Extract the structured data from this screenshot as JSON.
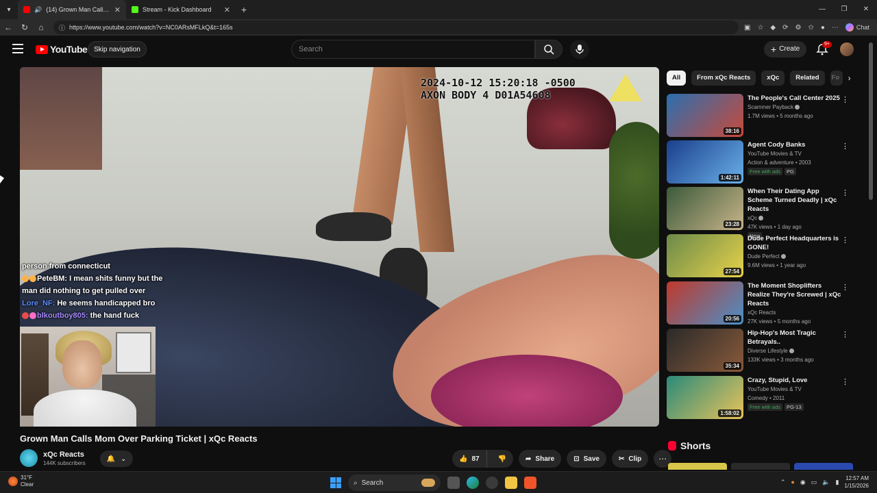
{
  "browser": {
    "tabs": [
      {
        "title": "(14) Grown Man Calls Mom O",
        "active": true,
        "favicon_color": "#ff0000"
      },
      {
        "title": "Stream - Kick Dashboard",
        "active": false,
        "favicon_color": "#53fc18"
      }
    ],
    "url": "https://www.youtube.com/watch?v=NC0ARsMFLkQ&t=165s",
    "copilot_label": "Chat"
  },
  "youtube": {
    "logo_text": "YouTube",
    "skip_nav": "Skip navigation",
    "search_placeholder": "Search",
    "create_label": "Create",
    "notif_badge": "9+"
  },
  "video": {
    "timestamp_line1": "2024-10-12 15:20:18 -0500",
    "timestamp_line2": "AXON BODY 4 D01A54608",
    "title": "Grown Man Calls Mom Over Parking Ticket | xQc Reacts",
    "chat": [
      {
        "user": "",
        "text": "person from connecticut"
      },
      {
        "user": "PeteBM:",
        "text": "I mean shits funny but the man did nothing to get pulled over"
      },
      {
        "user": "Lore_NF:",
        "text": "He seems handicapped bro"
      },
      {
        "user": "blkoutboy805:",
        "text": "the hand fuck"
      }
    ]
  },
  "channel": {
    "name": "xQc Reacts",
    "subscribers": "144K subscribers"
  },
  "actions": {
    "likes": "87",
    "share": "Share",
    "save": "Save",
    "clip": "Clip"
  },
  "chips": [
    "All",
    "From xQc Reacts",
    "xQc",
    "Related",
    "Fo"
  ],
  "recommendations": [
    {
      "title": "The People's Call Center 2025",
      "channel": "Scammer Payback",
      "verified": true,
      "line2": "1.7M views • 5 months ago",
      "line3": "",
      "duration": "38:16",
      "badges": [],
      "colors": [
        "#2a6fb0",
        "#c94a3a"
      ]
    },
    {
      "title": "Agent Cody Banks",
      "channel": "YouTube Movies & TV",
      "verified": false,
      "line2": "Action & adventure • 2003",
      "line3": "",
      "duration": "1:42:11",
      "badges": [
        "Free with ads",
        "PG"
      ],
      "colors": [
        "#1a3f8c",
        "#6ab0e8"
      ]
    },
    {
      "title": "When Their Dating App Scheme Turned Deadly | xQc Reacts",
      "channel": "xQc",
      "verified": true,
      "line2": "47K views • 1 day ago",
      "line3": "",
      "duration": "23:28",
      "badges": [
        "New"
      ],
      "colors": [
        "#3b5a3a",
        "#c9b48a"
      ]
    },
    {
      "title": "Dude Perfect Headquarters is GONE!",
      "channel": "Dude Perfect",
      "verified": true,
      "line2": "9.6M views • 1 year ago",
      "line3": "",
      "duration": "27:54",
      "badges": [],
      "colors": [
        "#6a8a4a",
        "#e8d24a"
      ]
    },
    {
      "title": "The Moment Shoplifters Realize They're Screwed | xQc Reacts",
      "channel": "xQc Reacts",
      "verified": false,
      "line2": "27K views • 5 months ago",
      "line3": "",
      "duration": "20:56",
      "badges": [],
      "colors": [
        "#c0392b",
        "#4a90c8"
      ]
    },
    {
      "title": "Hip-Hop's Most Tragic Betrayals..",
      "channel": "Diverse Lifestyle",
      "verified": true,
      "line2": "133K views • 3 months ago",
      "line3": "",
      "duration": "35:34",
      "badges": [],
      "colors": [
        "#2a2a2a",
        "#8a5a3a"
      ]
    },
    {
      "title": "Crazy, Stupid, Love",
      "channel": "YouTube Movies & TV",
      "verified": false,
      "line2": "Comedy • 2011",
      "line3": "",
      "duration": "1:58:02",
      "badges": [
        "Free with ads",
        "PG-13"
      ],
      "colors": [
        "#2a8a7a",
        "#e8c35a"
      ]
    }
  ],
  "shorts_label": "Shorts",
  "taskbar": {
    "temp": "31°F",
    "weather": "Clear",
    "search": "Search",
    "time": "12:57 AM",
    "date": "1/15/2026"
  }
}
